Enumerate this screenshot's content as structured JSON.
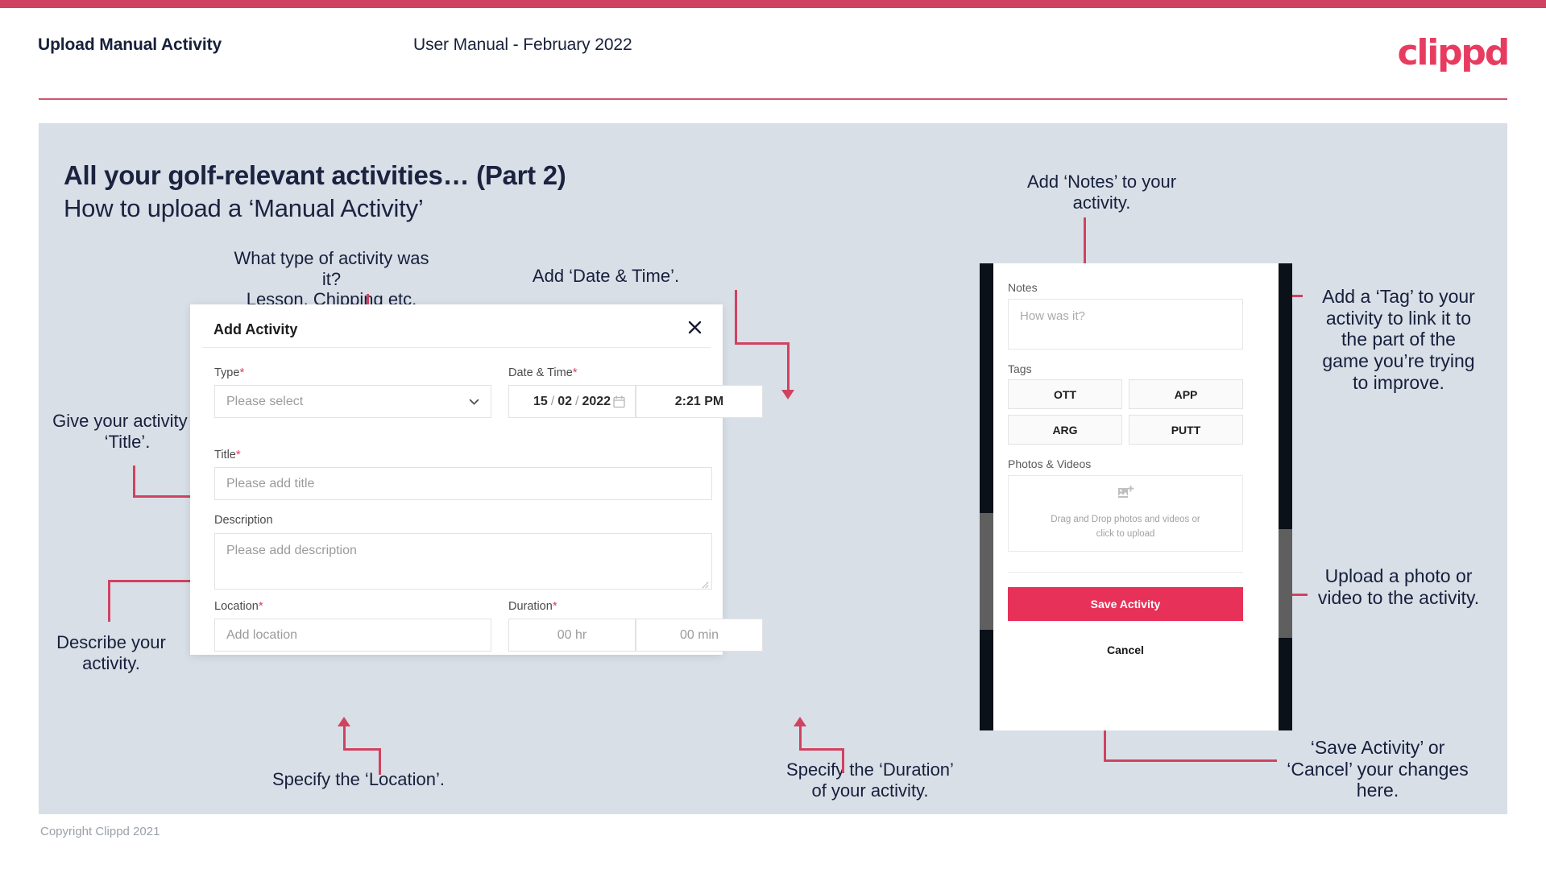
{
  "header": {
    "left_title": "Upload Manual Activity",
    "center_title": "User Manual - February 2022",
    "logo": "clippd",
    "accent_color": "#cf4360"
  },
  "slide": {
    "title": "All your golf-relevant activities… (Part 2)",
    "subtitle": "How to upload a ‘Manual Activity’",
    "panel_bg": "#d9dfe7"
  },
  "annotations": {
    "type_hint": "What type of activity was it?\nLesson, Chipping etc.",
    "datetime_hint": "Add ‘Date & Time’.",
    "title_hint": "Give your activity a\n‘Title’.",
    "description_hint": "Describe your\nactivity.",
    "location_hint": "Specify the ‘Location’.",
    "duration_hint": "Specify the ‘Duration’\nof your activity.",
    "notes_hint": "Add ‘Notes’ to your\nactivity.",
    "tag_hint": "Add a ‘Tag’ to your\nactivity to link it to\nthe part of the\ngame you’re trying\nto improve.",
    "upload_hint": "Upload a photo or\nvideo to the activity.",
    "save_hint": "‘Save Activity’ or\n‘Cancel’ your changes\nhere."
  },
  "dialog": {
    "title": "Add Activity",
    "close_icon": "close-icon",
    "fields": {
      "type": {
        "label": "Type",
        "required": "*",
        "placeholder": "Please select",
        "value": ""
      },
      "datetime": {
        "label": "Date & Time",
        "required": "*",
        "day": "15",
        "month": "02",
        "year": "2022",
        "sep": "/",
        "time": "2:21 PM",
        "calendar_icon": "calendar-icon"
      },
      "title": {
        "label": "Title",
        "required": "*",
        "placeholder": "Please add title",
        "value": ""
      },
      "description": {
        "label": "Description",
        "required": "",
        "placeholder": "Please add description",
        "value": ""
      },
      "location": {
        "label": "Location",
        "required": "*",
        "placeholder": "Add location",
        "value": ""
      },
      "duration": {
        "label": "Duration",
        "required": "*",
        "hours_placeholder": "00 hr",
        "minutes_placeholder": "00 min"
      }
    }
  },
  "phone": {
    "notes": {
      "label": "Notes",
      "placeholder": "How was it?",
      "value": ""
    },
    "tags": {
      "label": "Tags",
      "options": [
        "OTT",
        "APP",
        "ARG",
        "PUTT"
      ]
    },
    "photos": {
      "label": "Photos & Videos",
      "dropzone_text": "Drag and Drop photos and videos or\nclick to upload",
      "icon": "image-add-icon"
    },
    "save_label": "Save Activity",
    "cancel_label": "Cancel",
    "save_color": "#e73158"
  },
  "footer": {
    "copyright": "Copyright Clippd 2021"
  }
}
